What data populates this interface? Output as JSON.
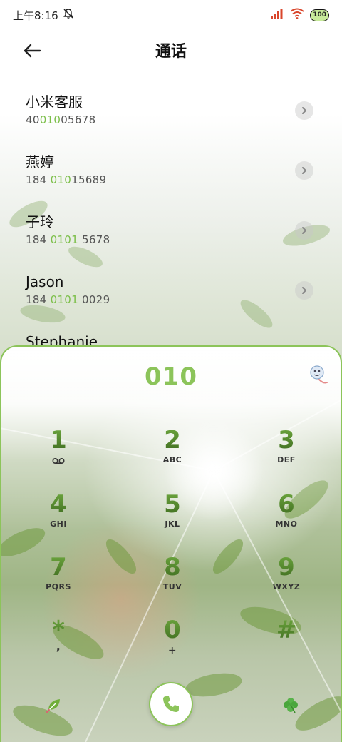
{
  "status_bar": {
    "time": "上午8:16",
    "battery": "100"
  },
  "header": {
    "title": "通话"
  },
  "contacts": [
    {
      "name": "小米客服",
      "number_pre": "40",
      "number_hl": "010",
      "number_post": "05678"
    },
    {
      "name": "燕婷",
      "number_pre": "184 ",
      "number_hl": "010",
      "number_post": "15689"
    },
    {
      "name": "子玲",
      "number_pre": "184 ",
      "number_hl": "0101",
      "number_post": " 5678"
    },
    {
      "name": "Jason",
      "number_pre": "184 ",
      "number_hl": "0101",
      "number_post": " 0029"
    },
    {
      "name": "Stephanie",
      "number_pre": "",
      "number_hl": "",
      "number_post": ""
    }
  ],
  "dialer": {
    "display": "010",
    "keys": [
      {
        "digit": "1",
        "letters": "",
        "icon": "voicemail-icon"
      },
      {
        "digit": "2",
        "letters": "ABC"
      },
      {
        "digit": "3",
        "letters": "DEF"
      },
      {
        "digit": "4",
        "letters": "GHI"
      },
      {
        "digit": "5",
        "letters": "JKL"
      },
      {
        "digit": "6",
        "letters": "MNO"
      },
      {
        "digit": "7",
        "letters": "PQRS"
      },
      {
        "digit": "8",
        "letters": "TUV"
      },
      {
        "digit": "9",
        "letters": "WXYZ"
      },
      {
        "digit": "*",
        "letters": ","
      },
      {
        "digit": "0",
        "letters": "+"
      },
      {
        "digit": "#",
        "letters": ""
      }
    ]
  },
  "colors": {
    "accent": "#8cc45a",
    "digit_green": "#4f7f2a",
    "highlight": "#7cbf4a"
  }
}
